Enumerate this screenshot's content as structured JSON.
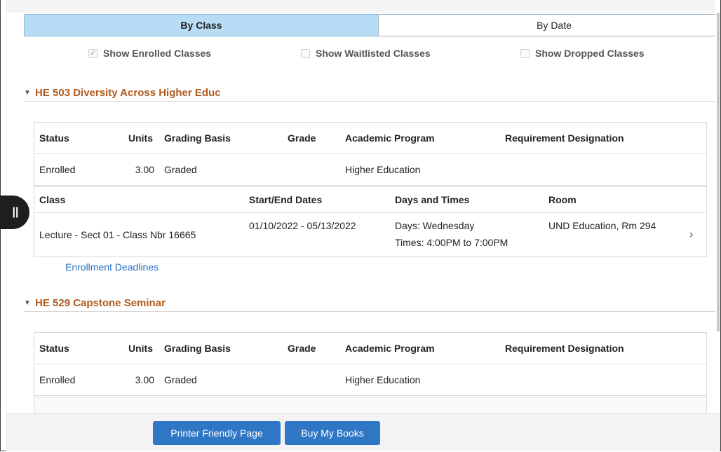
{
  "tabs": {
    "by_class": "By Class",
    "by_date": "By Date"
  },
  "filters": {
    "enrolled": {
      "label": "Show Enrolled Classes",
      "checked": true,
      "mark": "✓"
    },
    "waitlisted": {
      "label": "Show Waitlisted Classes",
      "checked": false
    },
    "dropped": {
      "label": "Show Dropped Classes",
      "checked": false
    }
  },
  "columns": {
    "status": "Status",
    "units": "Units",
    "grading": "Grading Basis",
    "grade": "Grade",
    "program": "Academic Program",
    "requirement": "Requirement Designation",
    "class": "Class",
    "dates": "Start/End Dates",
    "days_times": "Days and Times",
    "room": "Room"
  },
  "courses": [
    {
      "title": "HE 503 Diversity Across Higher Educ",
      "status": "Enrolled",
      "units": "3.00",
      "grading": "Graded",
      "grade": "",
      "program": "Higher Education",
      "requirement": "",
      "class": "Lecture - Sect 01 - Class Nbr 16665",
      "dates": "01/10/2022 - 05/13/2022",
      "days": "Days: Wednesday",
      "times": "Times: 4:00PM to 7:00PM",
      "room": "UND Education, Rm 294",
      "deadlines_link": "Enrollment Deadlines"
    },
    {
      "title": "HE 529 Capstone Seminar",
      "status": "Enrolled",
      "units": "3.00",
      "grading": "Graded",
      "grade": "",
      "program": "Higher Education",
      "requirement": ""
    }
  ],
  "footer": {
    "printer": "Printer Friendly Page",
    "books": "Buy My Books"
  },
  "icons": {
    "caret": "caret-down-icon",
    "chevron": "chevron-right-icon",
    "handle": "pause-handle-icon"
  },
  "colors": {
    "tab_active": "#b9dcf6",
    "course_title": "#b05a1d",
    "link": "#2a6fbf",
    "button": "#2f76c5"
  }
}
